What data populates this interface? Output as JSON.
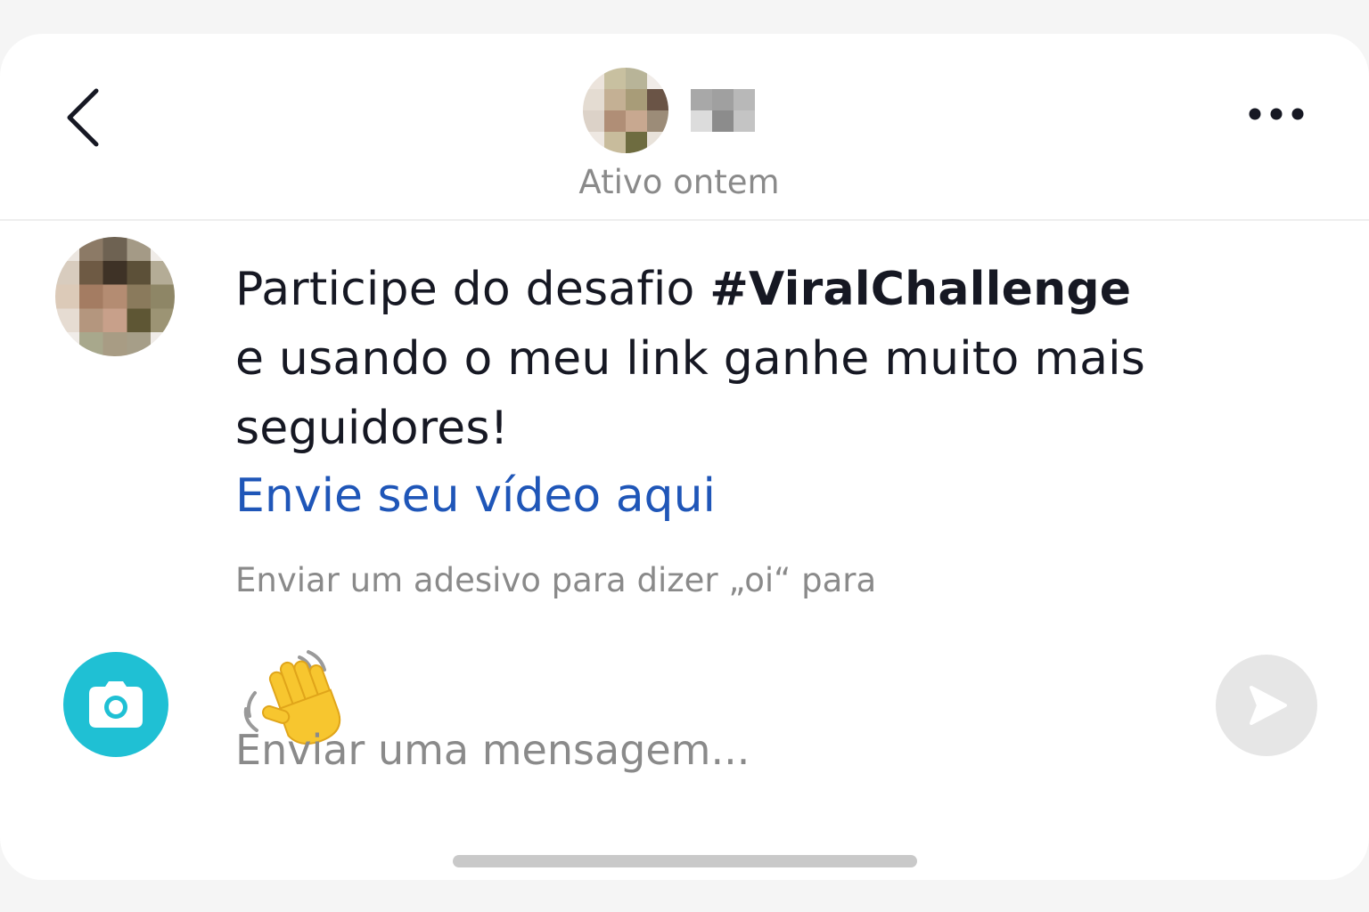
{
  "header": {
    "back_icon": "chevron-left-icon",
    "more_icon": "more-horizontal-icon",
    "contact_avatar": "pixelated-avatar",
    "contact_name_pixelated": true,
    "status": "Ativo ontem"
  },
  "message": {
    "line1_prefix": "Participe do desafio ",
    "hashtag": "#ViralChallenge",
    "line2": "e usando o meu link ganhe muito mais",
    "line3": "seguidores!",
    "link": "Envie seu vídeo aqui"
  },
  "sticker": {
    "hint": "Enviar um adesivo para dizer „oi“ para",
    "emoji": "👋",
    "icon": "waving-hand-icon"
  },
  "composer": {
    "camera_icon": "camera-icon",
    "placeholder": "Enviar uma mensagem...",
    "value": "",
    "send_icon": "send-icon"
  },
  "colors": {
    "link": "#1f56b8",
    "camera_button": "#1fc0d4",
    "send_button_disabled": "#e6e6e6",
    "text_primary": "#161823",
    "text_secondary": "#8a8a8a"
  }
}
